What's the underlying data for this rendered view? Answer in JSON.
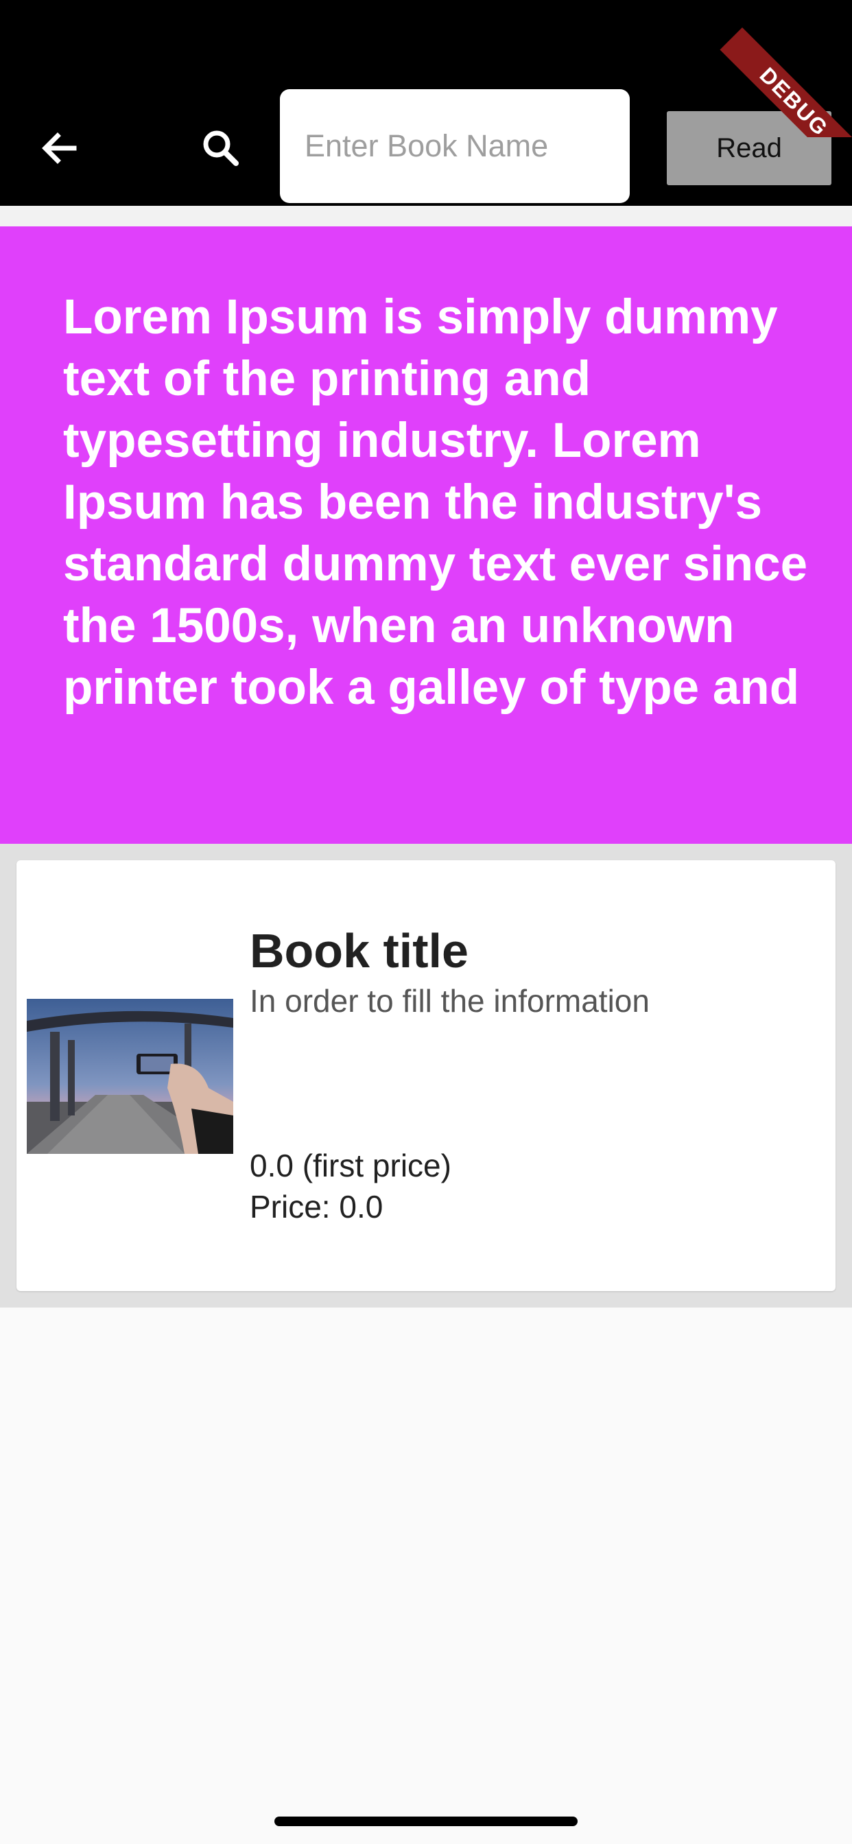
{
  "appbar": {
    "search_placeholder": "Enter Book Name",
    "read_label": "Read",
    "debug_label": "DEBUG",
    "back_icon": "arrow-back-icon",
    "search_icon": "search-icon"
  },
  "banner": {
    "text": "Lorem Ipsum is simply dummy text of the printing and typesetting industry. Lorem Ipsum has been the industry's standard dummy text ever since the 1500s, when an unknown printer took a galley of type and",
    "background": "#e040fb"
  },
  "book": {
    "title": "Book title",
    "subtitle": "In order to fill the information",
    "first_price": "0.0 (first price)",
    "price": "Price: 0.0"
  }
}
